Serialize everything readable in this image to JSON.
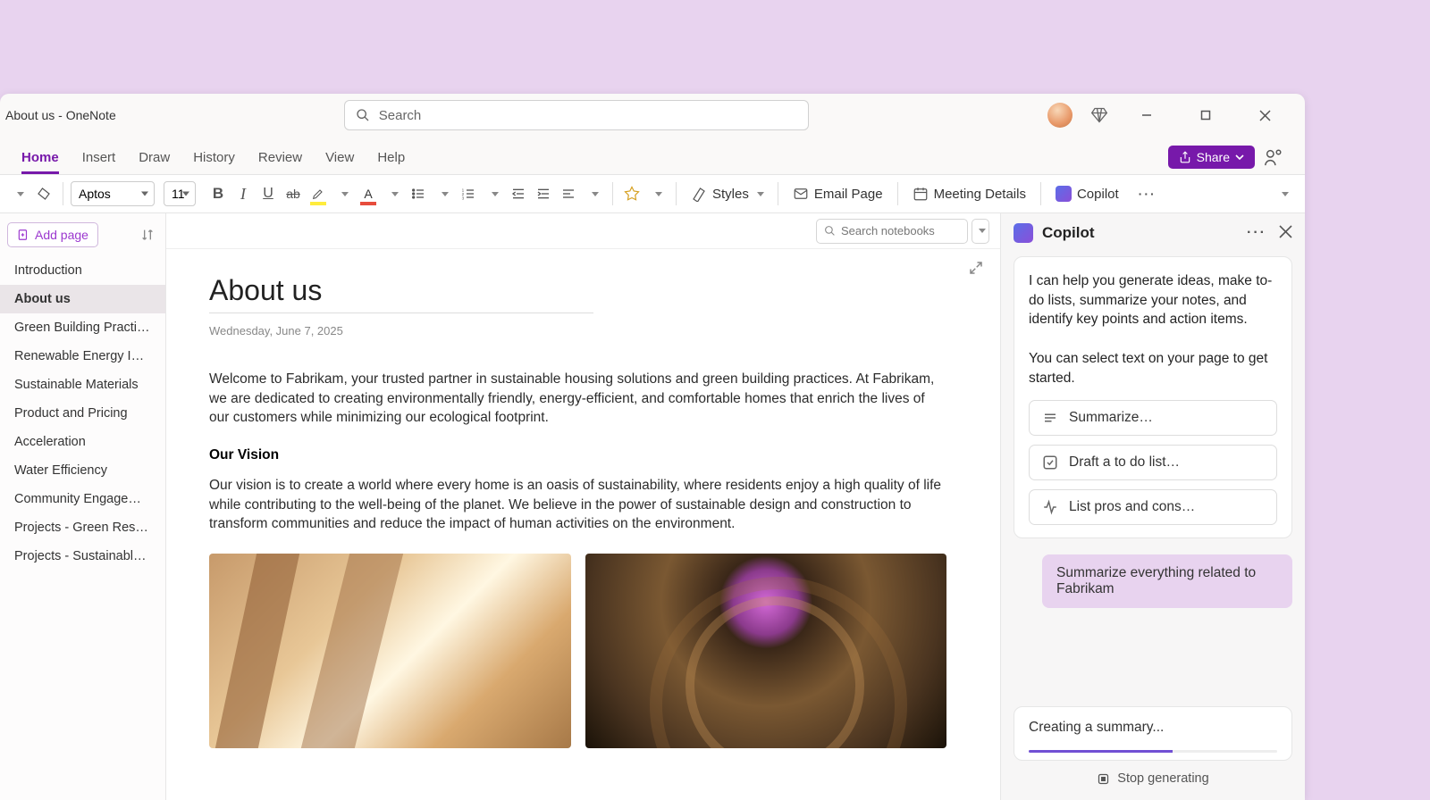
{
  "window": {
    "title": "About us - OneNote"
  },
  "search": {
    "placeholder": "Search"
  },
  "ribbon": {
    "tabs": [
      "Home",
      "Insert",
      "Draw",
      "History",
      "Review",
      "View",
      "Help"
    ],
    "active": 0,
    "share": "Share"
  },
  "toolbar": {
    "font_name": "Aptos",
    "font_size": "11",
    "styles": "Styles",
    "email": "Email Page",
    "meeting": "Meeting Details",
    "copilot": "Copilot"
  },
  "notebook_search": {
    "placeholder": "Search notebooks"
  },
  "pages": {
    "add_label": "Add page",
    "items": [
      "Introduction",
      "About us",
      "Green Building Practices",
      "Renewable Energy Integr…",
      "Sustainable Materials",
      "Product and Pricing",
      "Acceleration",
      "Water Efficiency",
      "Community Engagement",
      "Projects - Green Resident…",
      "Projects - Sustainable Mu…"
    ],
    "selected": 1
  },
  "page": {
    "title": "About us",
    "date": "Wednesday, June 7, 2025",
    "p1": "Welcome to Fabrikam, your trusted partner in sustainable housing solutions and green building practices. At Fabrikam, we are dedicated to creating environmentally friendly, energy-efficient, and comfortable homes that enrich the lives of our customers while minimizing our ecological footprint.",
    "h1": "Our Vision",
    "p2": "Our vision is to create a world where every home is an oasis of sustainability, where residents enjoy a high quality of life while contributing to the well-being of the planet. We believe in the power of sustainable design and construction to transform communities and reduce the impact of human activities on the environment."
  },
  "copilot": {
    "title": "Copilot",
    "intro1": "I can help you generate ideas, make to-do lists, summarize your notes, and identify key points and action items.",
    "intro2": "You can select text on your page to get started.",
    "suggestions": [
      "Summarize…",
      "Draft a to do list…",
      "List pros and cons…"
    ],
    "user_msg": "Summarize everything related to Fabrikam",
    "status": "Creating a summary...",
    "stop": "Stop generating"
  }
}
